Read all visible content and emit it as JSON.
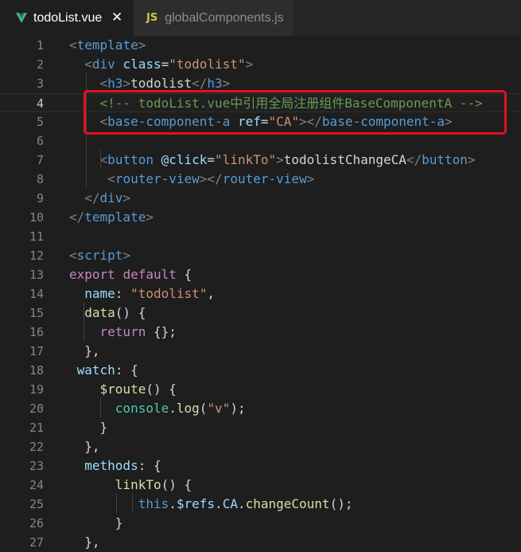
{
  "tabs": [
    {
      "label": "todoList.vue",
      "icon": "vue-icon",
      "active": true,
      "close": "✕"
    },
    {
      "label": "globalComponents.js",
      "icon": "js-icon",
      "icon_text": "JS",
      "active": false
    }
  ],
  "colors": {
    "tag": "#569cd6",
    "attribute": "#9cdcfe",
    "string": "#ce9178",
    "comment": "#6a9955",
    "text": "#d4d4d4",
    "highlight": "#e0131e"
  },
  "code_lines": [
    {
      "n": "1",
      "tokens": [
        [
          "t-punct",
          "<"
        ],
        [
          "t-tag",
          "template"
        ],
        [
          "t-punct",
          ">"
        ]
      ]
    },
    {
      "n": "2",
      "tokens": [
        [
          "t-text",
          "  "
        ],
        [
          "t-punct",
          "<"
        ],
        [
          "t-tag",
          "div"
        ],
        [
          "t-text",
          " "
        ],
        [
          "t-attr",
          "class"
        ],
        [
          "t-text",
          "="
        ],
        [
          "t-str",
          "\"todolist\""
        ],
        [
          "t-punct",
          ">"
        ]
      ]
    },
    {
      "n": "3",
      "tokens": [
        [
          "t-text",
          "    "
        ],
        [
          "t-punct",
          "<"
        ],
        [
          "t-tag",
          "h3"
        ],
        [
          "t-punct",
          ">"
        ],
        [
          "t-text",
          "todolist"
        ],
        [
          "t-punct",
          "</"
        ],
        [
          "t-tag",
          "h3"
        ],
        [
          "t-punct",
          ">"
        ]
      ]
    },
    {
      "n": "4",
      "current": true,
      "tokens": [
        [
          "t-text",
          "    "
        ],
        [
          "t-comment",
          "<!-- todoList.vue中引用全局注册组件BaseComponentA -->"
        ]
      ]
    },
    {
      "n": "5",
      "tokens": [
        [
          "t-text",
          "    "
        ],
        [
          "t-punct",
          "<"
        ],
        [
          "t-tag",
          "base-component-a"
        ],
        [
          "t-text",
          " "
        ],
        [
          "t-attr",
          "ref"
        ],
        [
          "t-text",
          "="
        ],
        [
          "t-str",
          "\"CA\""
        ],
        [
          "t-punct",
          "></"
        ],
        [
          "t-tag",
          "base-component-a"
        ],
        [
          "t-punct",
          ">"
        ]
      ]
    },
    {
      "n": "6",
      "tokens": []
    },
    {
      "n": "7",
      "tokens": [
        [
          "t-text",
          "    "
        ],
        [
          "t-punct",
          "<"
        ],
        [
          "t-tag",
          "button"
        ],
        [
          "t-text",
          " "
        ],
        [
          "t-attr",
          "@click"
        ],
        [
          "t-text",
          "="
        ],
        [
          "t-str",
          "\"linkTo\""
        ],
        [
          "t-punct",
          ">"
        ],
        [
          "t-text",
          "todolistChangeCA"
        ],
        [
          "t-punct",
          "</"
        ],
        [
          "t-tag",
          "button"
        ],
        [
          "t-punct",
          ">"
        ]
      ]
    },
    {
      "n": "8",
      "tokens": [
        [
          "t-text",
          "     "
        ],
        [
          "t-punct",
          "<"
        ],
        [
          "t-tag",
          "router-view"
        ],
        [
          "t-punct",
          "></"
        ],
        [
          "t-tag",
          "router-view"
        ],
        [
          "t-punct",
          ">"
        ]
      ]
    },
    {
      "n": "9",
      "tokens": [
        [
          "t-text",
          "  "
        ],
        [
          "t-punct",
          "</"
        ],
        [
          "t-tag",
          "div"
        ],
        [
          "t-punct",
          ">"
        ]
      ]
    },
    {
      "n": "10",
      "tokens": [
        [
          "t-punct",
          "</"
        ],
        [
          "t-tag",
          "template"
        ],
        [
          "t-punct",
          ">"
        ]
      ]
    },
    {
      "n": "11",
      "tokens": []
    },
    {
      "n": "12",
      "tokens": [
        [
          "t-punct",
          "<"
        ],
        [
          "t-tag",
          "script"
        ],
        [
          "t-punct",
          ">"
        ]
      ]
    },
    {
      "n": "13",
      "tokens": [
        [
          "t-ctrl",
          "export"
        ],
        [
          "t-text",
          " "
        ],
        [
          "t-ctrl",
          "default"
        ],
        [
          "t-text",
          " {"
        ]
      ]
    },
    {
      "n": "14",
      "tokens": [
        [
          "t-text",
          "  "
        ],
        [
          "t-prop",
          "name"
        ],
        [
          "t-text",
          ": "
        ],
        [
          "t-str",
          "\"todolist\""
        ],
        [
          "t-text",
          ","
        ]
      ]
    },
    {
      "n": "15",
      "tokens": [
        [
          "t-text",
          "  "
        ],
        [
          "t-fn",
          "data"
        ],
        [
          "t-text",
          "() {"
        ]
      ]
    },
    {
      "n": "16",
      "tokens": [
        [
          "t-text",
          "    "
        ],
        [
          "t-ctrl",
          "return"
        ],
        [
          "t-text",
          " {};"
        ]
      ]
    },
    {
      "n": "17",
      "tokens": [
        [
          "t-text",
          "  },"
        ]
      ]
    },
    {
      "n": "18",
      "tokens": [
        [
          "t-text",
          " "
        ],
        [
          "t-prop",
          "watch"
        ],
        [
          "t-text",
          ": {"
        ]
      ]
    },
    {
      "n": "19",
      "tokens": [
        [
          "t-text",
          "    "
        ],
        [
          "t-fn",
          "$route"
        ],
        [
          "t-text",
          "() {"
        ]
      ]
    },
    {
      "n": "20",
      "tokens": [
        [
          "t-text",
          "      "
        ],
        [
          "t-obj",
          "console"
        ],
        [
          "t-text",
          "."
        ],
        [
          "t-fn",
          "log"
        ],
        [
          "t-text",
          "("
        ],
        [
          "t-str",
          "\"v\""
        ],
        [
          "t-text",
          ");"
        ]
      ]
    },
    {
      "n": "21",
      "tokens": [
        [
          "t-text",
          "    }"
        ]
      ]
    },
    {
      "n": "22",
      "tokens": [
        [
          "t-text",
          "  },"
        ]
      ]
    },
    {
      "n": "23",
      "tokens": [
        [
          "t-text",
          "  "
        ],
        [
          "t-prop",
          "methods"
        ],
        [
          "t-text",
          ": {"
        ]
      ]
    },
    {
      "n": "24",
      "tokens": [
        [
          "t-text",
          "      "
        ],
        [
          "t-fn",
          "linkTo"
        ],
        [
          "t-text",
          "() {"
        ]
      ]
    },
    {
      "n": "25",
      "tokens": [
        [
          "t-text",
          "         "
        ],
        [
          "t-kw",
          "this"
        ],
        [
          "t-text",
          "."
        ],
        [
          "t-prop",
          "$refs"
        ],
        [
          "t-text",
          "."
        ],
        [
          "t-prop",
          "CA"
        ],
        [
          "t-text",
          "."
        ],
        [
          "t-fn",
          "changeCount"
        ],
        [
          "t-text",
          "();"
        ]
      ]
    },
    {
      "n": "26",
      "tokens": [
        [
          "t-text",
          "      }"
        ]
      ]
    },
    {
      "n": "27",
      "tokens": [
        [
          "t-text",
          "  },"
        ]
      ]
    }
  ]
}
